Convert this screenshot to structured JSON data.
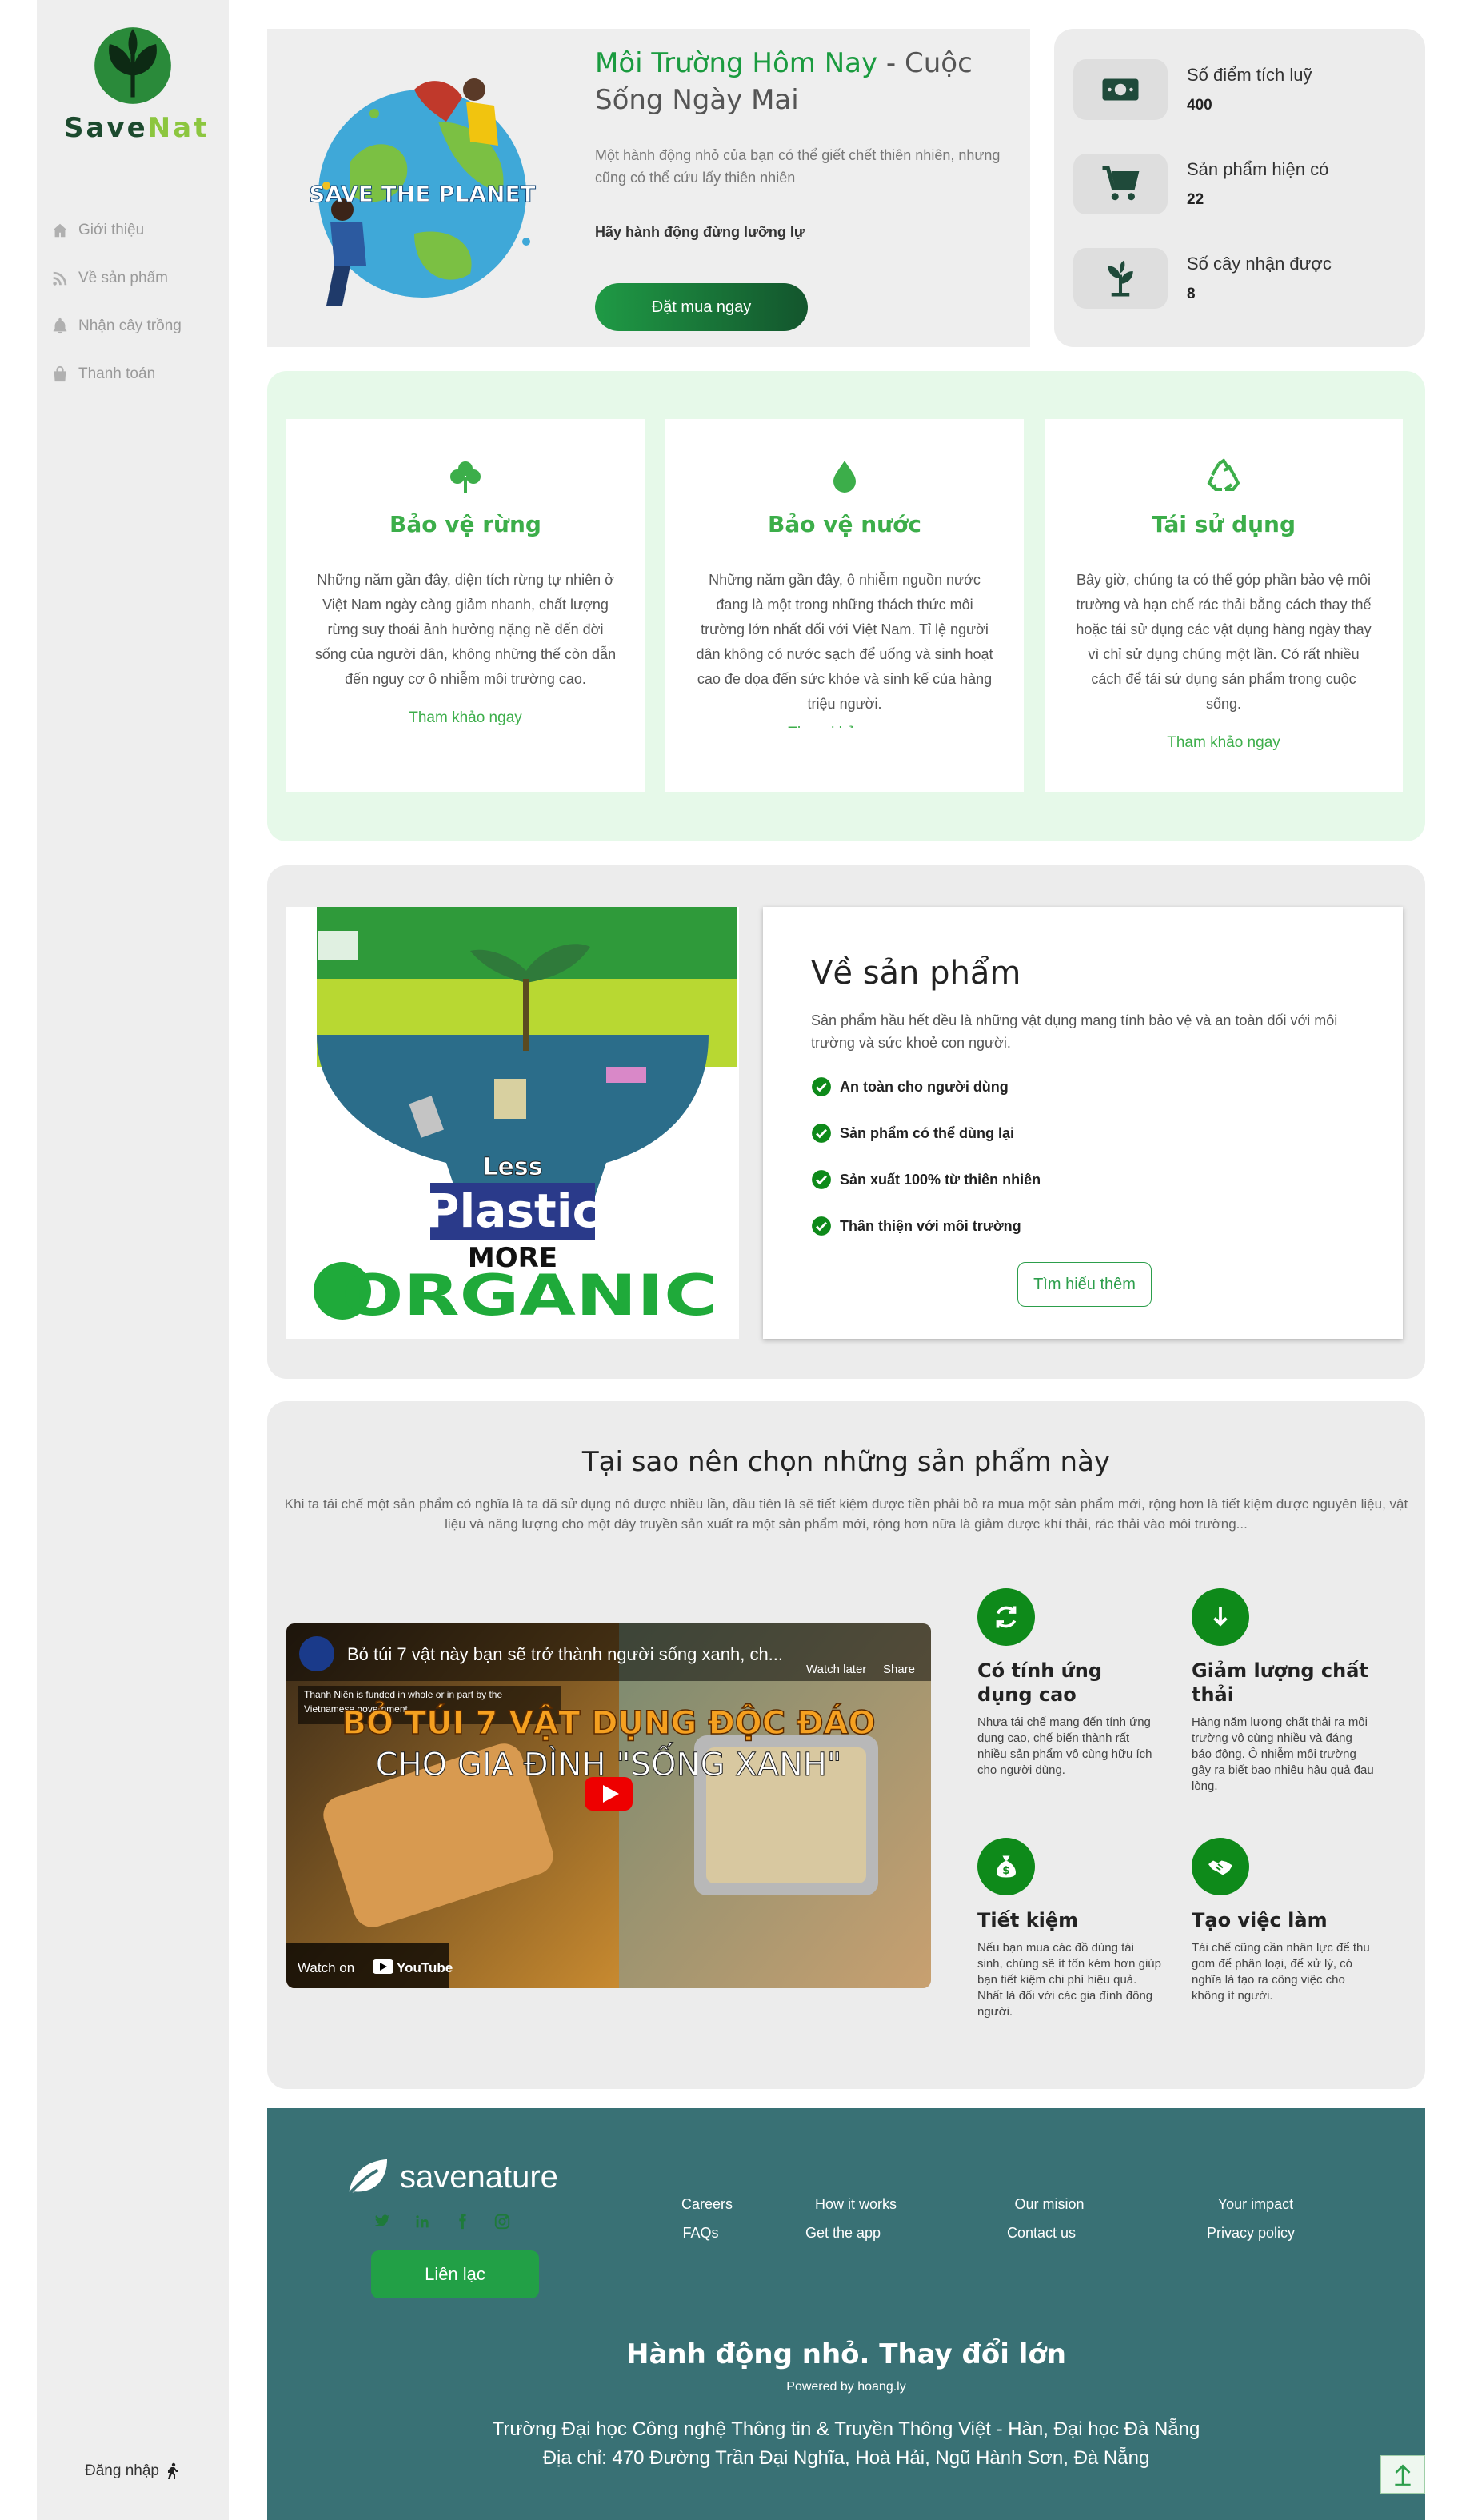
{
  "brand": {
    "part1": "Save",
    "part2": "Nat"
  },
  "sidebar": {
    "items": [
      {
        "label": "Giới thiệu",
        "icon": "home-icon"
      },
      {
        "label": "Về sản phẩm",
        "icon": "rss-icon"
      },
      {
        "label": "Nhận cây trồng",
        "icon": "bell-icon"
      },
      {
        "label": "Thanh toán",
        "icon": "bag-icon"
      }
    ],
    "login": "Đăng nhập"
  },
  "hero": {
    "title_green": "Môi Trường Hôm Nay",
    "title_rest": " - Cuộc Sống Ngày Mai",
    "desc": "Một hành động nhỏ của bạn có thể giết chết thiên nhiên, nhưng cũng có thể cứu lấy thiên nhiên",
    "sub": "Hãy hành động đừng lưỡng lự",
    "button": "Đặt mua ngay",
    "image_text": "SAVE THE PLANET"
  },
  "stats": [
    {
      "label": "Số điểm tích luỹ",
      "value": "400",
      "icon": "money-icon"
    },
    {
      "label": "Sản phẩm hiện có",
      "value": "22",
      "icon": "cart-icon"
    },
    {
      "label": "Số cây nhận được",
      "value": "8",
      "icon": "plant-icon"
    }
  ],
  "features": [
    {
      "title": "Bảo vệ rừng",
      "icon": "clover-icon",
      "text": "Những năm gần đây, diện tích rừng tự nhiên ở Việt Nam ngày càng giảm nhanh, chất lượng rừng suy thoái ảnh hưởng nặng nề đến đời sống của người dân, không những thế còn dẫn đến nguy cơ ô nhiễm môi trường cao.",
      "link": "Tham khảo ngay"
    },
    {
      "title": "Bảo vệ nước",
      "icon": "water-drop-icon",
      "text": "Những năm gần đây, ô nhiễm nguồn nước đang là một trong những thách thức môi trường lớn nhất đối với Việt Nam. Tỉ lệ người dân không có nước sạch để uống và sinh hoạt cao đe dọa đến sức khỏe và sinh kế của hàng triệu người.",
      "link": "Tham khảo ngay"
    },
    {
      "title": "Tái sử dụng",
      "icon": "recycle-icon",
      "text": "Bây giờ, chúng ta có thể góp phần bảo vệ môi trường và hạn chế rác thải bằng cách thay thế hoặc tái sử dụng các vật dụng hàng ngày thay vì chỉ sử dụng chúng một lần. Có rất nhiều cách để tái sử dụng sản phẩm trong cuộc sống.",
      "link": "Tham khảo ngay"
    }
  ],
  "product": {
    "title": "Về sản phẩm",
    "desc": "Sản phẩm hầu hết đều là những vật dụng mang tính bảo vệ và an toàn đối với môi trường và sức khoẻ con người.",
    "checks": [
      "An toàn cho người dùng",
      "Sản phẩm có thể dùng lại",
      "Sản xuất 100% từ thiên nhiên",
      "Thân thiện với môi trường"
    ],
    "button": "Tìm hiểu thêm",
    "poster": {
      "less": "Less",
      "plastic": "Plastic",
      "more": "MORE",
      "organic": "ORGANIC"
    }
  },
  "why": {
    "title": "Tại sao nên chọn những sản phẩm này",
    "desc": "Khi ta tái chế một sản phẩm có nghĩa là ta đã sử dụng nó được nhiều lần, đầu tiên là sẽ tiết kiệm được tiền phải bỏ ra mua một sản phẩm mới, rộng hơn là tiết kiệm được nguyên liệu, vật liệu và năng lượng cho một dây truyền sản xuất ra một sản phẩm mới, rộng hơn nữa là giảm được khí thải, rác thải vào môi trường...",
    "video": {
      "title": "Bỏ túi 7 vật này bạn sẽ trở thành người sống xanh, ch...",
      "watch_later": "Watch later",
      "share": "Share",
      "notice": "Thanh Niên is funded in whole or in part by the Vietnamese government.",
      "line1": "BỎ TÚI 7 VẬT DỤNG ĐỘC ĐÁO",
      "line2": "CHO GIA ĐÌNH \"SỐNG XANH\"",
      "watch_on": "Watch on",
      "youtube": "YouTube"
    },
    "benefits": [
      {
        "title": "Có tính ứng dụng cao",
        "icon": "refresh-icon",
        "text": "Nhựa tái chế mang đến tính ứng dụng cao, chế biến thành rất nhiều sản phẩm vô cùng hữu ích cho người dùng."
      },
      {
        "title": "Giảm lượng chất thải",
        "icon": "arrow-down-icon",
        "text": "Hàng năm lượng chất thải ra môi trường vô cùng nhiều và đáng báo động. Ô nhiễm môi trường gây ra biết bao nhiêu hậu quả đau lòng."
      },
      {
        "title": "Tiết kiệm",
        "icon": "money-bag-icon",
        "text": "Nếu bạn mua các đồ dùng tái sinh, chúng sẽ ít tốn kém hơn giúp bạn tiết kiệm chi phí hiệu quả. Nhất là đối với các gia đình đông người."
      },
      {
        "title": "Tạo việc làm",
        "icon": "handshake-icon",
        "text": "Tái chế cũng cần nhân lực để thu gom để phân loại, để xử lý, có nghĩa là tạo ra công việc cho không ít người."
      }
    ]
  },
  "footer": {
    "brand": "savenature",
    "contact_button": "Liên lạc",
    "links": [
      [
        "Careers",
        "FAQs"
      ],
      [
        "How it works",
        "Get the app"
      ],
      [
        "Our mision",
        "Contact us"
      ],
      [
        "Your impact",
        "Privacy policy"
      ]
    ],
    "slogan": "Hành động nhỏ. Thay đổi lớn",
    "powered": "Powered by hoang.ly",
    "address1": "Trường Đại học Công nghệ Thông tin & Truyền Thông Việt - Hàn, Đại học Đà Nẵng",
    "address2": "Địa chỉ: 470 Đường Trần Đại Nghĩa, Hoà Hải, Ngũ Hành Sơn, Đà Nẵng"
  },
  "colors": {
    "green": "#1a9b3f",
    "footer": "#397175",
    "feature_bg": "#e6f9e9",
    "panel": "#ececec"
  }
}
